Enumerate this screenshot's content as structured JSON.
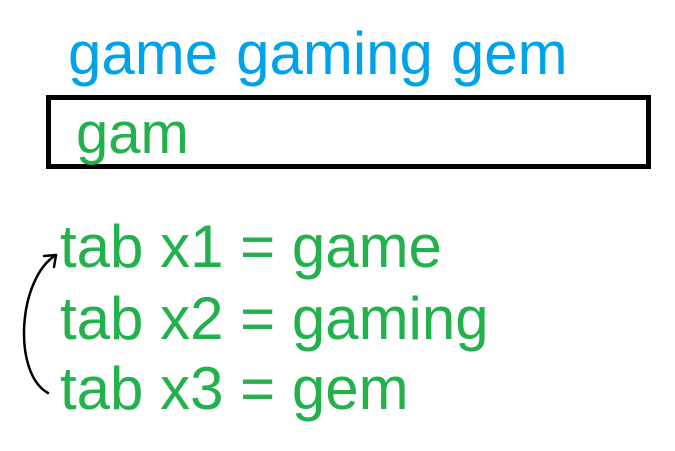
{
  "suggestions": [
    "game",
    "gaming",
    "gem"
  ],
  "input": {
    "value": "gam"
  },
  "tab_cycle": [
    {
      "label": "tab x1 = game"
    },
    {
      "label": "tab x2 = gaming"
    },
    {
      "label": "tab x3 = gem"
    }
  ],
  "colors": {
    "suggestion": "#00a2e8",
    "typed_text": "#22b14c",
    "input_border": "#000000",
    "arrow": "#000000"
  },
  "icons": {
    "cycle_arrow": "curved-arrow-icon"
  }
}
